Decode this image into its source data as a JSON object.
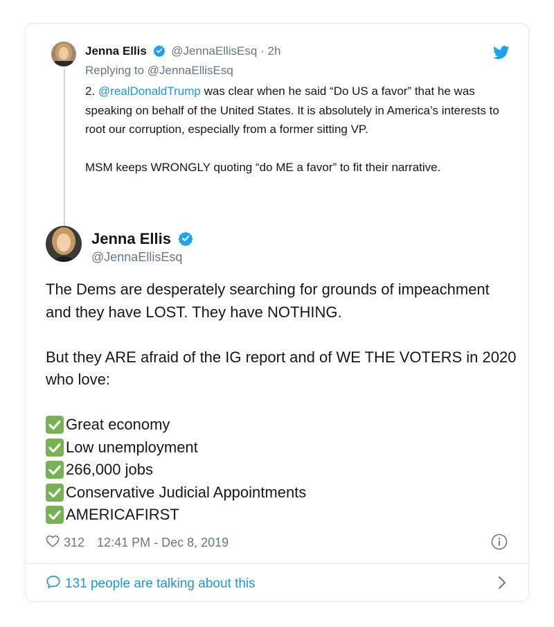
{
  "reply_tweet": {
    "author_name": "Jenna Ellis",
    "author_handle": "@JennaEllisEsq",
    "separator": "·",
    "time": "2h",
    "replying_to": "Replying to @JennaEllisEsq",
    "body_prefix": "2. ",
    "mention": "@realDonaldTrump",
    "body_rest": " was clear when he said “Do US a favor” that he was speaking on behalf of the United States. It is absolutely in America’s interests to root our corruption, especially from a former sitting VP.",
    "body_p2": "MSM keeps WRONGLY quoting “do ME a favor” to fit their narrative."
  },
  "main_tweet": {
    "author_name": "Jenna Ellis",
    "author_handle": "@JennaEllisEsq",
    "paragraph1": "The Dems are desperately searching for grounds of impeachment and they have LOST. They have NOTHING.",
    "paragraph2": "But they ARE afraid of the IG report and of WE THE VOTERS in 2020 who love:",
    "checklist": [
      "Great economy",
      "Low unemployment",
      "266,000 jobs",
      "Conservative Judicial Appointments",
      "AMERICAFIRST"
    ],
    "likes": "312",
    "timestamp": "12:41 PM - Dec 8, 2019",
    "talking": "131 people are talking about this"
  },
  "icons": {
    "verified": "verified-badge-icon",
    "twitter": "twitter-bird-icon",
    "like": "heart-icon",
    "info": "info-icon",
    "comment": "speech-bubble-icon",
    "chevron": "chevron-right-icon",
    "check": "check-mark-icon"
  },
  "colors": {
    "brand_blue": "#1da1f2",
    "link_blue": "#1b95e0",
    "muted_gray": "#657786",
    "check_green": "#77b255"
  }
}
